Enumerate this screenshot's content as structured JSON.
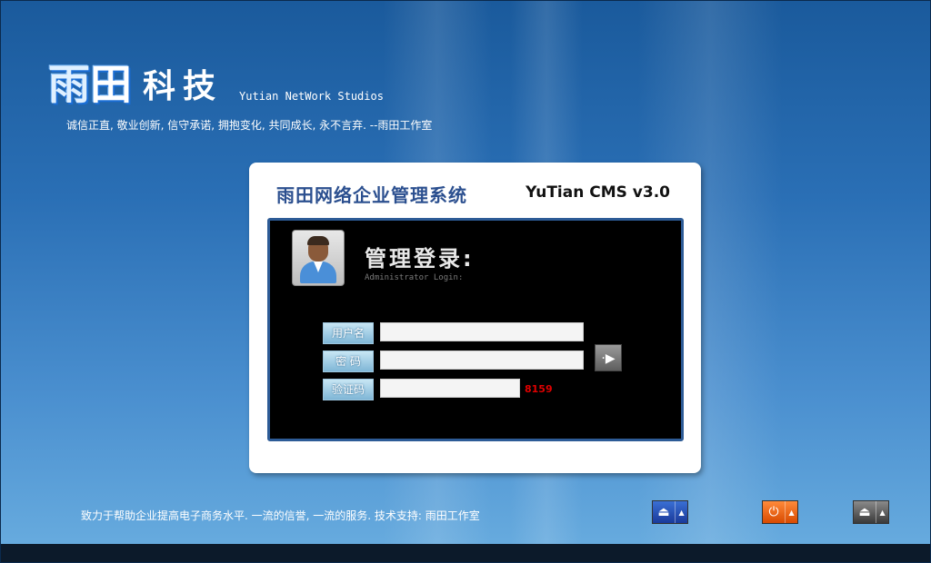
{
  "brand": {
    "glyph1": "雨",
    "glyph2": "田",
    "name_cn": "科技",
    "name_en": "Yutian NetWork Studios",
    "slogan": "诚信正直, 敬业创新, 信守承诺, 拥抱变化, 共同成长, 永不言弃. --雨田工作室"
  },
  "card": {
    "title_cn": "雨田网络企业管理系统",
    "title_en": "YuTian CMS v3.0"
  },
  "login": {
    "title": "管理登录:",
    "subtitle": "Administrator Login:",
    "username_label": "用户名",
    "username_value": "",
    "password_label": "密 码",
    "password_value": "",
    "captcha_label": "验证码",
    "captcha_value": "",
    "captcha_code": "8159",
    "submit_glyph": "·▶"
  },
  "footer": {
    "text": "致力于帮助企业提高电子商务水平.  一流的信誉, 一流的服务. 技术支持: 雨田工作室",
    "btn_eject_blue_glyph": "⏏",
    "btn_power_glyph": "⏻",
    "btn_eject_gray_glyph": "⏏",
    "dropdown_glyph": "▲"
  },
  "colors": {
    "card_title": "#2b4f8f",
    "captcha_code": "#e00000",
    "panel_border": "#2d5b96"
  }
}
